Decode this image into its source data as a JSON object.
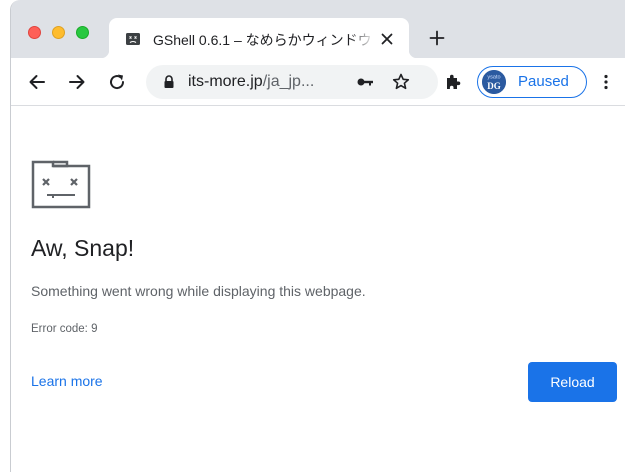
{
  "tab": {
    "title": "GShell 0.6.1 – なめらかウィンドウ",
    "favicon": "sad-tab-icon"
  },
  "toolbar": {
    "url_host": "its-more.jp",
    "url_path": "/ja_jp...",
    "profile_label": "Paused",
    "avatar_text": "DG"
  },
  "error_page": {
    "title": "Aw, Snap!",
    "message": "Something went wrong while displaying this webpage.",
    "code": "Error code: 9",
    "learn_more": "Learn more",
    "reload": "Reload"
  },
  "colors": {
    "accent": "#1a73e8",
    "tabstrip": "#dee1e6",
    "omnibox": "#f1f3f4"
  }
}
